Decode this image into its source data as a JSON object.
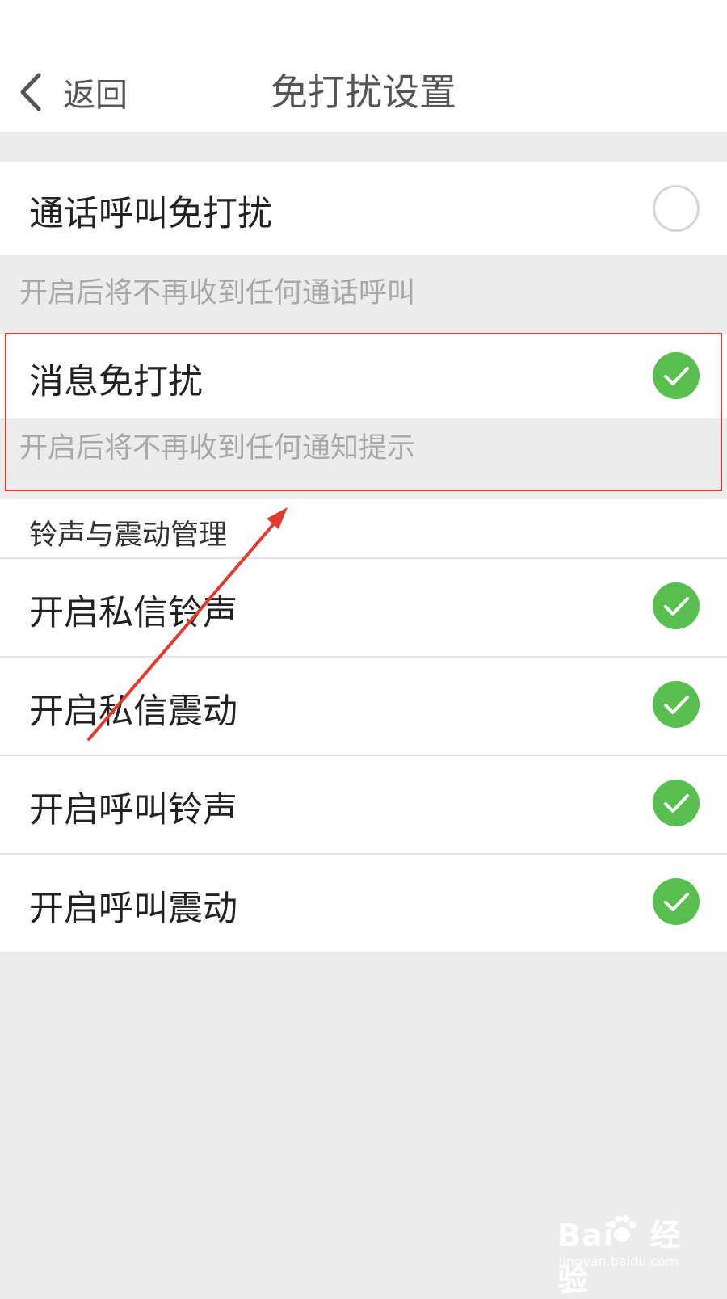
{
  "header": {
    "back_label": "返回",
    "title": "免打扰设置"
  },
  "settings": [
    {
      "label": "通话呼叫免打扰",
      "enabled": false,
      "description": "开启后将不再收到任何通话呼叫"
    },
    {
      "label": "消息免打扰",
      "enabled": true,
      "description": "开启后将不再收到任何通知提示"
    }
  ],
  "section": {
    "title": "铃声与震动管理",
    "items": [
      {
        "label": "开启私信铃声",
        "enabled": true
      },
      {
        "label": "开启私信震动",
        "enabled": true
      },
      {
        "label": "开启呼叫铃声",
        "enabled": true
      },
      {
        "label": "开启呼叫震动",
        "enabled": true
      }
    ]
  },
  "colors": {
    "toggle_on": "#58be4e",
    "toggle_off_border": "#d6d6d6",
    "annotation": "#e23a2f"
  },
  "icons": {
    "back": "chevron-left-icon",
    "check": "check-icon"
  },
  "watermark": {
    "brand_left": "Bai",
    "brand_right": "经验",
    "url": "jingyan.baidu.com"
  }
}
